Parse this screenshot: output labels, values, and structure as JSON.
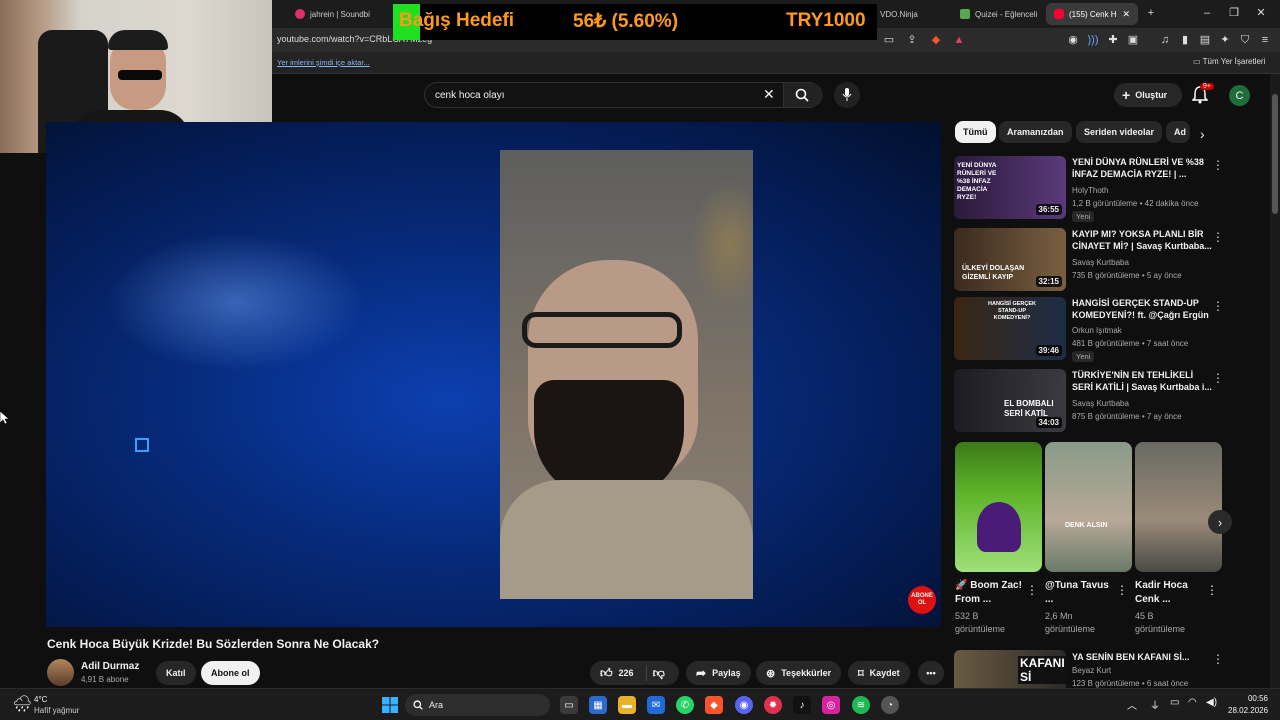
{
  "browser": {
    "tabs": [
      {
        "label": "jahrein | Soundbi"
      },
      {
        "label": "VDO.Ninja"
      },
      {
        "label": "Quizei - Eğlenceli"
      },
      {
        "label": "(155) Cenk H"
      }
    ],
    "address": "youtube.com/watch?v=CRbLCAYMzeg",
    "bookmarks": {
      "import_label": "Yer imlerini şimdi içe aktar...",
      "all_label": "Tüm Yer İşaretleri"
    }
  },
  "donation_overlay": {
    "title": "Bağış Hedefi",
    "current": "56₺ (5.60%)",
    "goal": "TRY1000",
    "progress_percent": 5.6
  },
  "youtube": {
    "search": {
      "value": "cenk hoca olayı"
    },
    "create_label": "Oluştur",
    "notif_badge": "9+",
    "avatar_letter": "C",
    "video": {
      "title": "Cenk Hoca Büyük Krizde! Bu Sözlerden Sonra Ne Olacak?",
      "channel": "Adil Durmaz",
      "subscribers": "4,91 B abone",
      "join_label": "Katıl",
      "subscribe_label": "Abone ol",
      "likes": "226",
      "share_label": "Paylaş",
      "thanks_label": "Teşekkürler",
      "save_label": "Kaydet",
      "watermark": "ABONE OL"
    },
    "chips": [
      "Tümü",
      "Aramanızdan",
      "Seriden videolar",
      "Ad"
    ],
    "recommended": [
      {
        "title": "YENİ DÜNYA RÜNLERİ VE %38 İNFAZ DEMACİA RYZE! | ...",
        "channel": "HolyThoth",
        "meta": "1,2 B görüntüleme • 42 dakika önce",
        "badge": "Yeni",
        "duration": "36:55",
        "thumb_text": "YENİ DÜNYA RÜNLERİ VE %38 İNFAZ DEMACİA RYZE!"
      },
      {
        "title": "KAYIP MI? YOKSA PLANLI BİR CİNAYET Mİ? | Savaş Kurtbaba...",
        "channel": "Savaş Kurtbaba",
        "meta": "735 B görüntüleme • 5 ay önce",
        "badge": "",
        "duration": "32:15",
        "thumb_text": "ÜLKEYİ DOLAŞAN GİZEMLİ KAYIP"
      },
      {
        "title": "HANGİSİ GERÇEK STAND-UP KOMEDYENİ?! ft. @Çağrı Ergün",
        "channel": "Orkun Işıtmak",
        "meta": "481 B görüntüleme • 7 saat önce",
        "badge": "Yeni",
        "duration": "39:46",
        "thumb_text": "HANGİSİ GERÇEK STAND-UP KOMEDYENİ?"
      },
      {
        "title": "TÜRKİYE'NİN EN TEHLİKELİ SERİ KATİLİ | Savaş Kurtbaba i...",
        "channel": "Savaş Kurtbaba",
        "meta": "875 B görüntüleme • 7 ay önce",
        "badge": "",
        "duration": "34:03",
        "thumb_text": "EL BOMBALI SERİ KATİL"
      }
    ],
    "shorts": [
      {
        "title": "🚀 Boom Zac! From ...",
        "views": "532 B görüntüleme",
        "thumb_text": ""
      },
      {
        "title": "@Tuna Tavus ...",
        "views": "2,6 Mn görüntüleme",
        "thumb_text": "DENK ALSIN"
      },
      {
        "title": "Kadir Hoca Cenk ...",
        "views": "45 B görüntüleme",
        "thumb_text": ""
      }
    ],
    "bottom_rec": {
      "title": "YA SENİN BEN KAFANI Sİ...",
      "channel": "Beyaz Kurt",
      "meta": "123 B görüntüleme • 6 saat önce",
      "thumb_text": "KAFANI Sİ"
    }
  },
  "taskbar": {
    "weather_temp": "4°C",
    "weather_desc": "Hafif yağmur",
    "search_placeholder": "Ara",
    "time": "00:56",
    "date": "28.02.2026"
  }
}
